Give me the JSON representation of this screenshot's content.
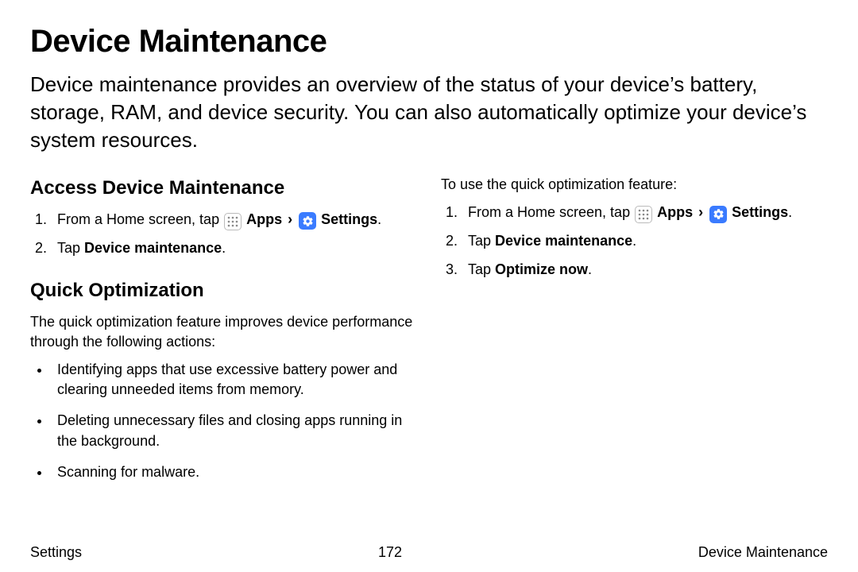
{
  "title": "Device Maintenance",
  "intro": "Device maintenance provides an overview of the status of your device’s battery, storage, RAM, and device security. You can also automatically optimize your device’s system resources.",
  "left": {
    "heading1": "Access Device Maintenance",
    "step1_pre": "From a Home screen, tap ",
    "apps_label": "Apps",
    "chevron": "›",
    "settings_label": "Settings",
    "period": ".",
    "step2_pre": "Tap ",
    "step2_bold": "Device maintenance",
    "heading2": "Quick Optimization",
    "quick_intro": "The quick optimization feature improves device performance through the following actions:",
    "bullet1": "Identifying apps that use excessive battery power and clearing unneeded items from memory.",
    "bullet2": "Deleting unnecessary files and closing apps running in the background.",
    "bullet3": "Scanning for malware."
  },
  "right": {
    "lead": "To use the quick optimization feature:",
    "step1_pre": "From a Home screen, tap ",
    "apps_label": "Apps",
    "chevron": "›",
    "settings_label": "Settings",
    "period": ".",
    "step2_pre": "Tap ",
    "step2_bold": "Device maintenance",
    "step3_pre": "Tap ",
    "step3_bold": "Optimize now"
  },
  "footer": {
    "left": "Settings",
    "center": "172",
    "right": "Device Maintenance"
  }
}
